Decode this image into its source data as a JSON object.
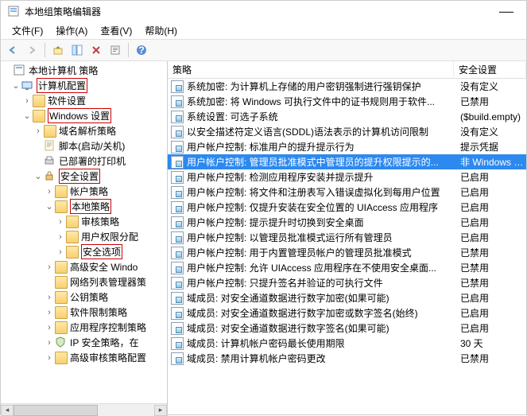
{
  "window": {
    "title": "本地组策略编辑器"
  },
  "menu": {
    "file": "文件(F)",
    "action": "操作(A)",
    "view": "查看(V)",
    "help": "帮助(H)"
  },
  "tree": {
    "root": "本地计算机 策略",
    "computer_config": "计算机配置",
    "software_settings": "软件设置",
    "windows_settings": "Windows 设置",
    "name_resolution": "域名解析策略",
    "scripts": "脚本(启动/关机)",
    "deployed_printers": "已部署的打印机",
    "security_settings": "安全设置",
    "account_policies": "帐户策略",
    "local_policies": "本地策略",
    "audit_policy": "审核策略",
    "user_rights": "用户权限分配",
    "security_options": "安全选项",
    "adv_security": "高级安全 Windo",
    "network_list": "网络列表管理器策",
    "public_key": "公钥策略",
    "software_restrict": "软件限制策略",
    "app_control": "应用程序控制策略",
    "ip_security": "IP 安全策略，在",
    "adv_audit": "高级审核策略配置"
  },
  "list": {
    "header": {
      "policy": "策略",
      "setting": "安全设置"
    },
    "rows": [
      {
        "p": "系统加密: 为计算机上存储的用户密钥强制进行强钥保护",
        "s": "没有定义"
      },
      {
        "p": "系统加密: 将 Windows 可执行文件中的证书规则用于软件...",
        "s": "已禁用"
      },
      {
        "p": "系统设置: 可选子系统",
        "s": "($build.empty)"
      },
      {
        "p": "以安全描述符定义语言(SDDL)语法表示的计算机访问限制",
        "s": "没有定义"
      },
      {
        "p": "用户帐户控制: 标准用户的提升提示行为",
        "s": "提示凭据"
      },
      {
        "p": "用户帐户控制: 管理员批准模式中管理员的提升权限提示的...",
        "s": "非 Windows 二进",
        "sel": true
      },
      {
        "p": "用户帐户控制: 检测应用程序安装并提示提升",
        "s": "已启用"
      },
      {
        "p": "用户帐户控制: 将文件和注册表写入错误虚拟化到每用户位置",
        "s": "已启用"
      },
      {
        "p": "用户帐户控制: 仅提升安装在安全位置的 UIAccess 应用程序",
        "s": "已启用"
      },
      {
        "p": "用户帐户控制: 提示提升时切换到安全桌面",
        "s": "已启用"
      },
      {
        "p": "用户帐户控制: 以管理员批准模式运行所有管理员",
        "s": "已启用"
      },
      {
        "p": "用户帐户控制: 用于内置管理员帐户的管理员批准模式",
        "s": "已禁用"
      },
      {
        "p": "用户帐户控制: 允许 UIAccess 应用程序在不使用安全桌面...",
        "s": "已禁用"
      },
      {
        "p": "用户帐户控制: 只提升签名并验证的可执行文件",
        "s": "已禁用"
      },
      {
        "p": "域成员: 对安全通道数据进行数字加密(如果可能)",
        "s": "已启用"
      },
      {
        "p": "域成员: 对安全通道数据进行数字加密或数字签名(始终)",
        "s": "已启用"
      },
      {
        "p": "域成员: 对安全通道数据进行数字签名(如果可能)",
        "s": "已启用"
      },
      {
        "p": "域成员: 计算机帐户密码最长使用期限",
        "s": "30 天"
      },
      {
        "p": "域成员: 禁用计算机帐户密码更改",
        "s": "已禁用"
      }
    ]
  }
}
